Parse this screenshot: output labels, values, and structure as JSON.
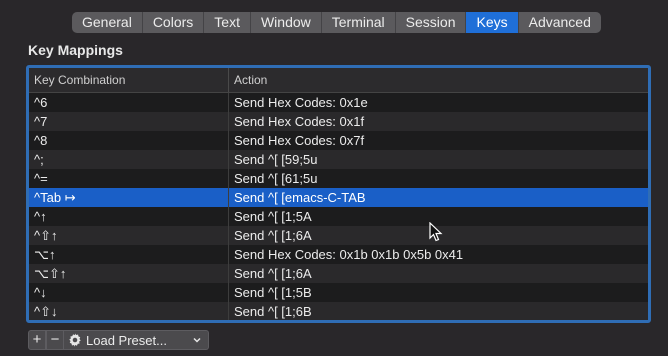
{
  "tabs": [
    "General",
    "Colors",
    "Text",
    "Window",
    "Terminal",
    "Session",
    "Keys",
    "Advanced"
  ],
  "active_tab": "Keys",
  "section_title": "Key Mappings",
  "table": {
    "columns": [
      "Key Combination",
      "Action"
    ],
    "rows": [
      {
        "key": "^6",
        "action": "Send Hex Codes: 0x1e"
      },
      {
        "key": "^7",
        "action": "Send Hex Codes: 0x1f"
      },
      {
        "key": "^8",
        "action": "Send Hex Codes: 0x7f"
      },
      {
        "key": "^;",
        "action": "Send ^[ [59;5u"
      },
      {
        "key": "^=",
        "action": "Send ^[ [61;5u"
      },
      {
        "key": "^Tab ↦",
        "action": "Send ^[ [emacs-C-TAB",
        "selected": true
      },
      {
        "key": "^↑",
        "action": "Send ^[ [1;5A"
      },
      {
        "key": "^⇧↑",
        "action": "Send ^[ [1;6A"
      },
      {
        "key": "⌥↑",
        "action": "Send Hex Codes: 0x1b 0x1b 0x5b 0x41"
      },
      {
        "key": "⌥⇧↑",
        "action": "Send ^[ [1;6A"
      },
      {
        "key": "^↓",
        "action": "Send ^[ [1;5B"
      },
      {
        "key": "^⇧↓",
        "action": "Send ^[ [1;6B"
      }
    ]
  },
  "bottom": {
    "add_label": "+",
    "remove_label": "−",
    "preset_label": "Load Preset...",
    "preset_icon": "gear-icon"
  },
  "colors": {
    "accent": "#1f6fd8",
    "selected_row": "#1a5fc7",
    "table_border": "#2f6db5",
    "background": "#29272a"
  }
}
